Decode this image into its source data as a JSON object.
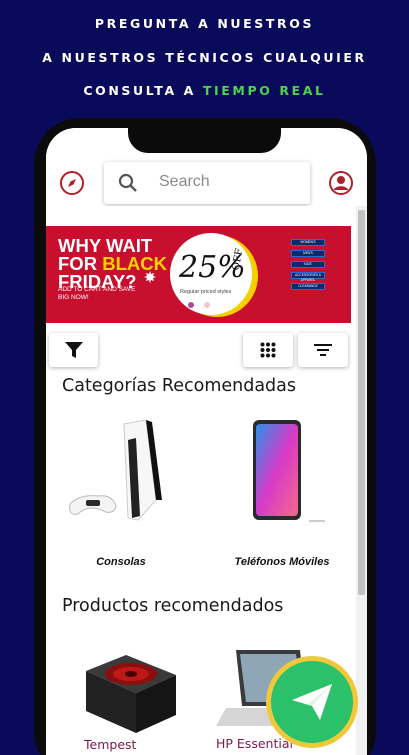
{
  "headline": {
    "line1": "PREGUNTA A NUESTROS",
    "line2": "A NUESTROS TÉCNICOS CUALQUIER",
    "line3_prefix": "CONSULTA A ",
    "line3_accent": "TIEMPO REAL"
  },
  "search": {
    "placeholder": "Search"
  },
  "banner": {
    "line1": "WHY WAIT",
    "line2_prefix": "FOR ",
    "line2_accent": "BLACK",
    "line2b": "FRIDAY?",
    "sub": "ADD TO CART AND SAVE BIG NOW!",
    "percent": "25%",
    "off": "OFF",
    "regular": "Regular priced styles",
    "nav": [
      "WOMEN'S",
      "MEN'S",
      "KIDS'",
      "ACCESSORIES & APPAREL",
      "CLEARANCE"
    ]
  },
  "categories": {
    "title": "Categorías Recomendadas",
    "items": [
      {
        "label": "Consolas"
      },
      {
        "label": "Teléfonos Móviles"
      }
    ]
  },
  "products": {
    "title": "Productos recomendados",
    "items": [
      {
        "label": "Tempest"
      },
      {
        "label": "HP Essential"
      }
    ]
  },
  "colors": {
    "background": "#0a0a5a",
    "accent_green": "#4cd44c",
    "brand_red": "#c8102e",
    "fab_green": "#2bc06a",
    "fab_ring": "#f0c83a"
  },
  "icons": [
    "compass-icon",
    "search-icon",
    "profile-icon",
    "filter-icon",
    "grid-icon",
    "sort-icon",
    "send-icon"
  ]
}
